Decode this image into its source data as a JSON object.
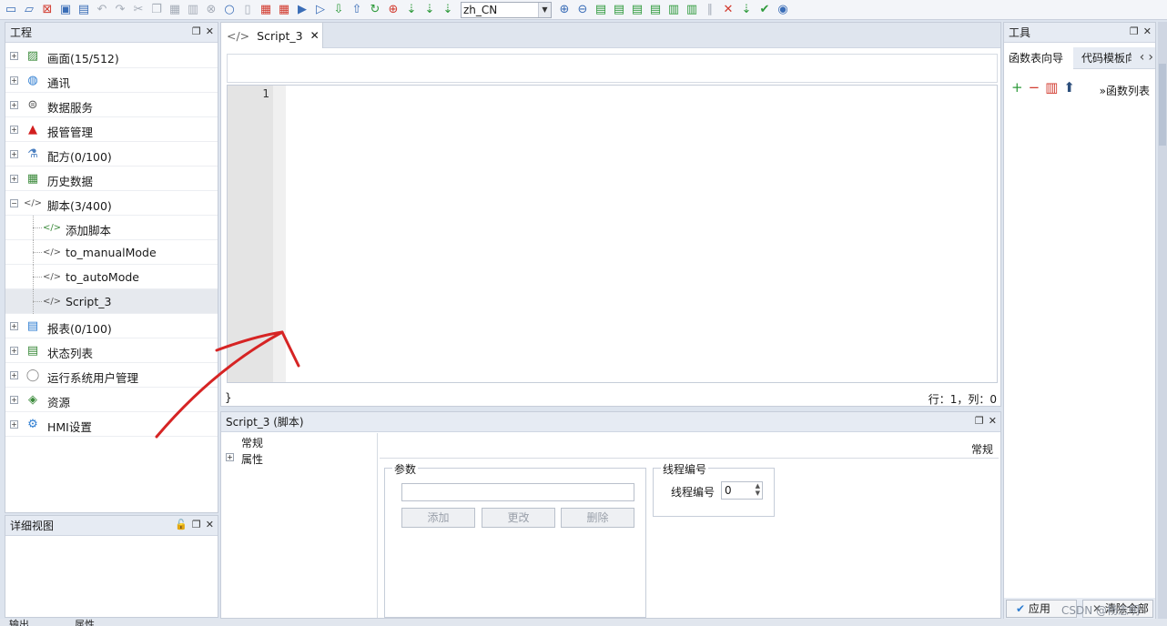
{
  "toolbar": {
    "language": "zh_CN",
    "icons": [
      "new-icon",
      "open-icon",
      "close-icon",
      "save-icon",
      "print-icon",
      "undo-icon",
      "redo-icon",
      "cut-icon",
      "copy-icon",
      "paste-icon",
      "delete-icon",
      "clear-icon",
      "search-icon",
      "replace-icon",
      "compile-icon",
      "download-icon",
      "simulate-icon",
      "test-icon",
      "import-icon",
      "export-icon",
      "refresh-icon",
      "network-icon",
      "upload-icon",
      "upload2-icon",
      "upload3-icon"
    ]
  },
  "project_panel": {
    "title": "工程",
    "items": [
      {
        "label": "画面(15/512)",
        "icon": "screen-icon",
        "expand": "+"
      },
      {
        "label": "通讯",
        "icon": "globe-icon",
        "expand": "+"
      },
      {
        "label": "数据服务",
        "icon": "database-icon",
        "expand": "+"
      },
      {
        "label": "报管管理",
        "icon": "alarm-icon",
        "expand": "+"
      },
      {
        "label": "配方(0/100)",
        "icon": "flask-icon",
        "expand": "+"
      },
      {
        "label": "历史数据",
        "icon": "history-icon",
        "expand": "+"
      },
      {
        "label": "脚本(3/400)",
        "icon": "script-icon",
        "expand": "−"
      },
      {
        "label": "添加脚本",
        "icon": "add-script-icon",
        "child": true
      },
      {
        "label": "to_manualMode",
        "icon": "script-icon",
        "child": true
      },
      {
        "label": "to_autoMode",
        "icon": "script-icon",
        "child": true
      },
      {
        "label": "Script_3",
        "icon": "script-icon",
        "child": true,
        "selected": true
      },
      {
        "label": "报表(0/100)",
        "icon": "report-icon",
        "expand": "+"
      },
      {
        "label": "状态列表",
        "icon": "list-icon",
        "expand": "+"
      },
      {
        "label": "运行系统用户管理",
        "icon": "user-icon",
        "expand": "+"
      },
      {
        "label": "资源",
        "icon": "resource-icon",
        "expand": "+"
      },
      {
        "label": "HMI设置",
        "icon": "gear-icon",
        "expand": "+"
      }
    ]
  },
  "detail_panel": {
    "title": "详细视图"
  },
  "editor": {
    "tab_label": "Script_3",
    "line_number": "1",
    "brace": "}",
    "position": "行：1，列：0"
  },
  "props_panel": {
    "title": "Script_3 (脚本)",
    "nav": [
      {
        "label": "常规"
      },
      {
        "label": "属性"
      }
    ],
    "section_title": "常规",
    "params_group": "参数",
    "add_label": "添加",
    "modify_label": "更改",
    "delete_label": "删除",
    "thread_group": "线程编号",
    "thread_label": "线程编号",
    "thread_value": "0"
  },
  "tools_panel": {
    "title": "工具",
    "tab1": "函数表向导",
    "tab2": "代码模板向导",
    "func_list": "»函数列表",
    "apply_label": "应用",
    "clear_label": "清除全部"
  },
  "bottom": {
    "tab1": "输出",
    "tab2": "属性"
  },
  "watermark": "CSDN @杨志明"
}
